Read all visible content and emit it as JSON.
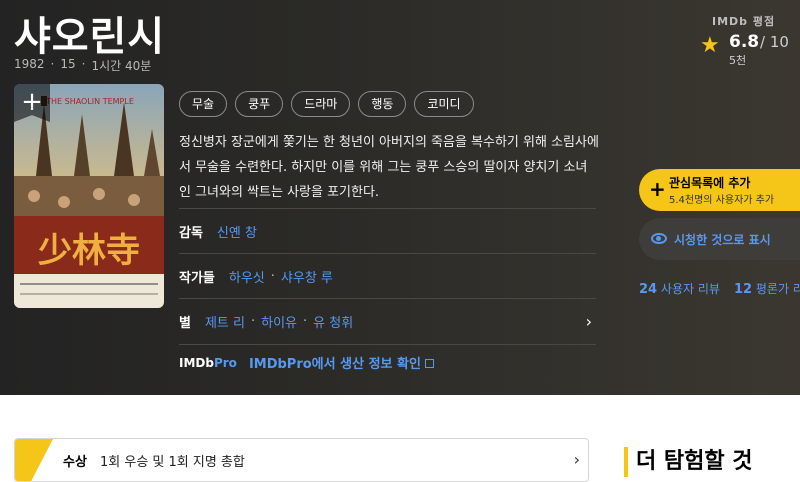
{
  "movie": {
    "title": "샤오린시",
    "year": "1982",
    "age_rating": "15",
    "runtime": "1시간 40분",
    "plot": "정신병자 장군에게 쫓기는 한 청년이 아버지의 죽음을 복수하기 위해 소림사에서 무술을 수련한다. 하지만 이를 위해 그는 쿵푸 스승의 딸이자 양치기 소녀인 그녀와의 싹트는 사랑을 포기한다.",
    "genres": [
      "무술",
      "쿵푸",
      "드라마",
      "행동",
      "코미디"
    ]
  },
  "rating": {
    "label": "IMDb 평점",
    "score": "6.8",
    "max": "/ 10",
    "count": "5천"
  },
  "poster": {
    "title_en": "THE SHAOLIN TEMPLE",
    "title_cn": "少林寺",
    "add_symbol": "+"
  },
  "credits": {
    "director_label": "감독",
    "directors": [
      "신옌 창"
    ],
    "writers_label": "작가들",
    "writers": [
      "하우싯",
      "샤우창 루"
    ],
    "stars_label": "별",
    "stars": [
      "제트 리",
      "하이유",
      "유 청휘"
    ],
    "separator": "·"
  },
  "imdbpro": {
    "logo_a": "IMDb",
    "logo_b": "Pro",
    "link": "IMDbPro에서 생산 정보 확인"
  },
  "actions": {
    "watchlist_label": "관심목록에 추가",
    "watchlist_sub": "5.4천명의 사용자가 추가",
    "watched_label": "시청한 것으로 표시",
    "user_reviews_count": "24",
    "user_reviews_label": "사용자 리뷰",
    "critic_reviews_count": "12",
    "critic_reviews_label": "평론가 리"
  },
  "awards": {
    "label": "수상",
    "text": "1회 우승 및 1회 지명 총합"
  },
  "explore": {
    "title": "더 탐험할 것"
  },
  "colors": {
    "accent": "#f5c518",
    "link": "#5799ef",
    "hero_bg": "#2b2a27"
  }
}
